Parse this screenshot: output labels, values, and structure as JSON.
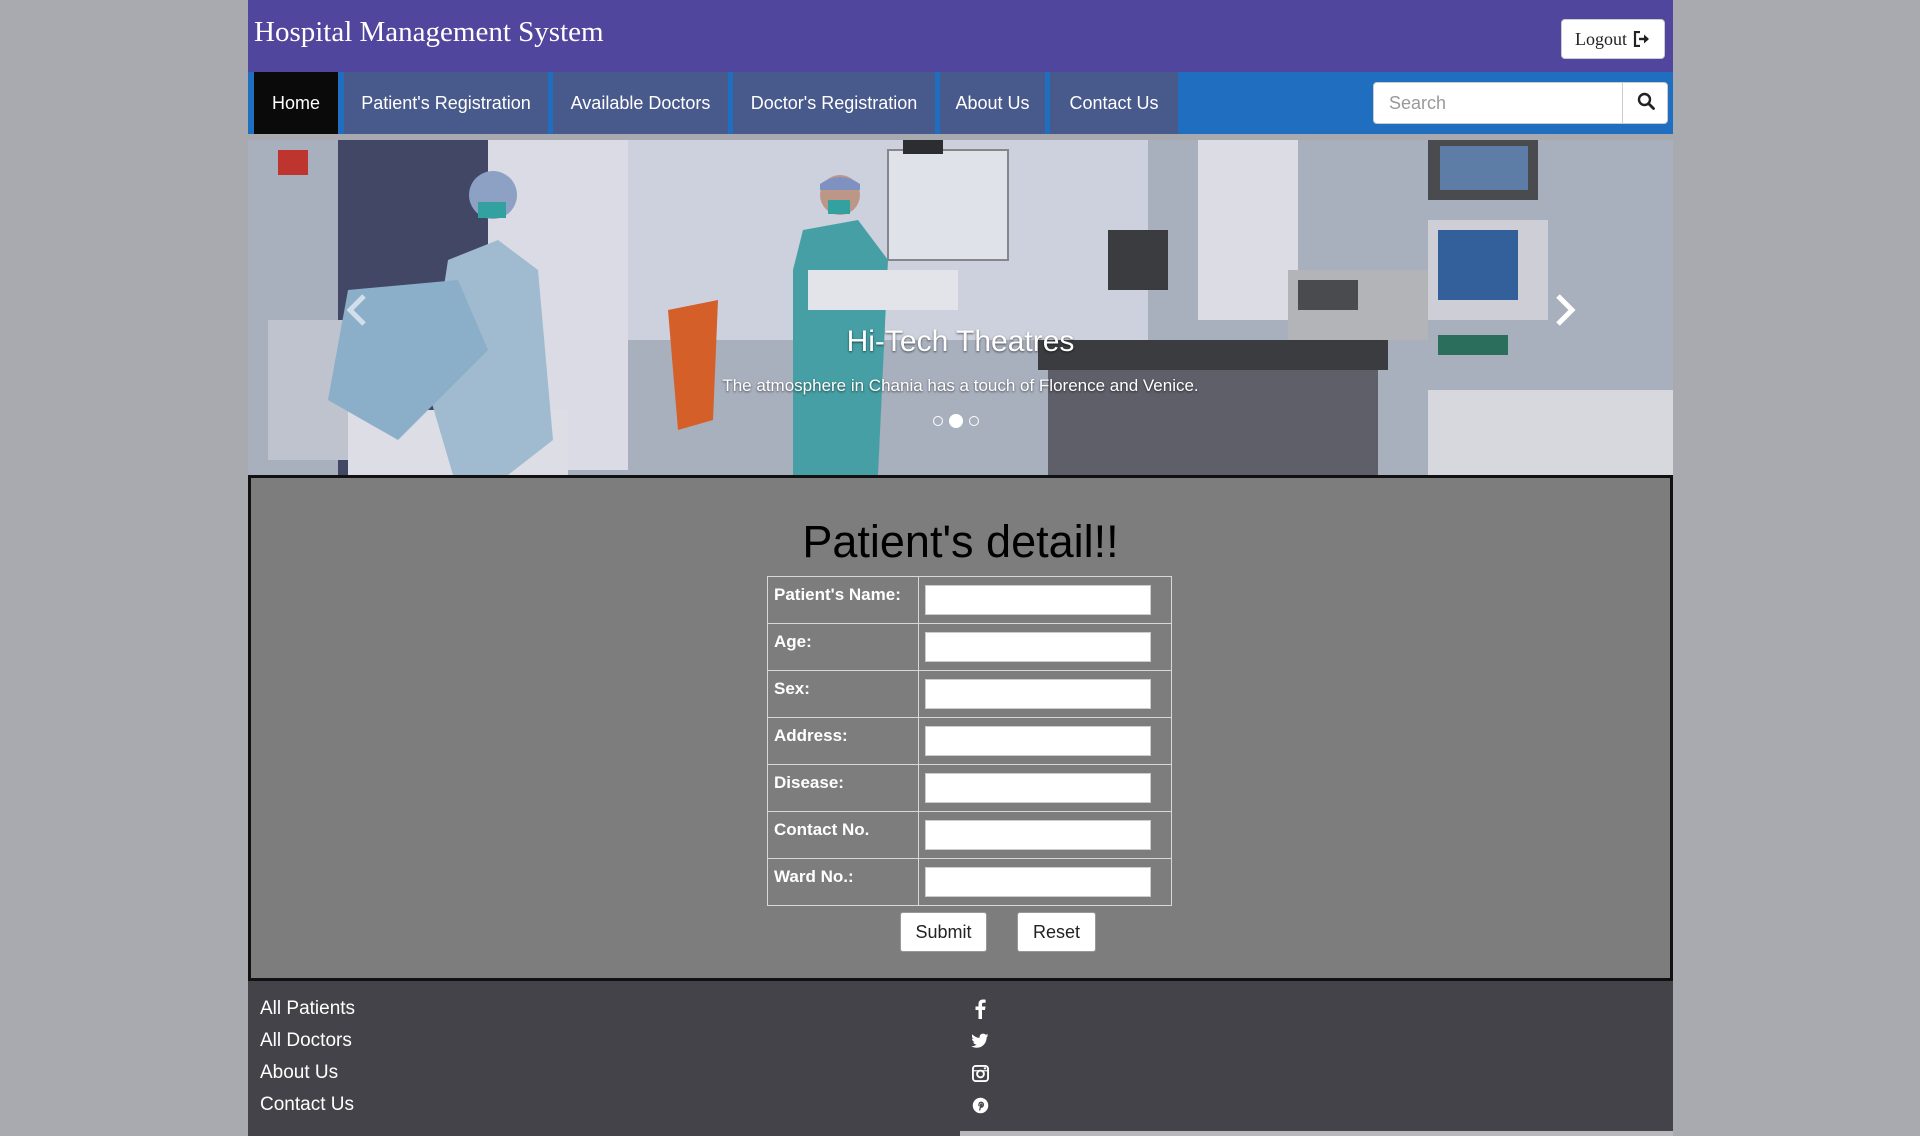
{
  "header": {
    "brand": "Hospital Management System",
    "logout_label": "Logout",
    "bg_color": "#50469d"
  },
  "nav": {
    "items": [
      {
        "label": "Home",
        "active": true
      },
      {
        "label": "Patient's Registration",
        "active": false
      },
      {
        "label": "Available Doctors",
        "active": false
      },
      {
        "label": "Doctor's Registration",
        "active": false
      },
      {
        "label": "About Us",
        "active": false
      },
      {
        "label": "Contact Us",
        "active": false
      }
    ],
    "search_placeholder": "Search",
    "search_icon": "search-icon",
    "bar_color": "#1f6ec0"
  },
  "carousel": {
    "title": "Hi-Tech Theatres",
    "text": "The atmosphere in Chania has a touch of Florence and Venice.",
    "slide_count": 3,
    "active_slide": 2
  },
  "main": {
    "title": "Patient's detail!!",
    "fields": [
      {
        "label": "Patient's Name:",
        "value": ""
      },
      {
        "label": "Age:",
        "value": ""
      },
      {
        "label": "Sex:",
        "value": ""
      },
      {
        "label": "Address:",
        "value": ""
      },
      {
        "label": "Disease:",
        "value": ""
      },
      {
        "label": "Contact No.",
        "value": ""
      },
      {
        "label": "Ward No.:",
        "value": ""
      }
    ],
    "submit_label": "Submit",
    "reset_label": "Reset"
  },
  "footer": {
    "links": [
      "All Patients",
      "All Doctors",
      "About Us",
      "Contact Us"
    ],
    "social": [
      "facebook-icon",
      "twitter-icon",
      "instagram-icon",
      "pinterest-icon"
    ]
  }
}
